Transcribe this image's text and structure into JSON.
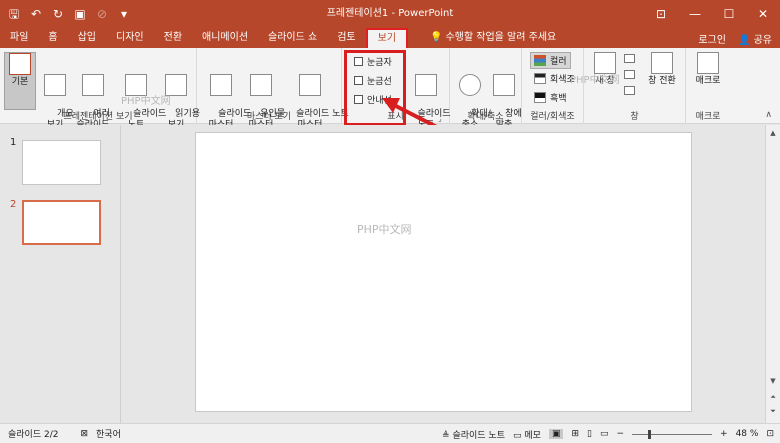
{
  "window": {
    "title": "프레젠테이션1 - PowerPoint"
  },
  "tabs": [
    {
      "label": "파일"
    },
    {
      "label": "홈"
    },
    {
      "label": "삽입"
    },
    {
      "label": "디자인"
    },
    {
      "label": "전환"
    },
    {
      "label": "애니메이션"
    },
    {
      "label": "슬라이드 쇼"
    },
    {
      "label": "검토"
    },
    {
      "label": "보기"
    }
  ],
  "tell_me": "수행할 작업을 알려 주세요",
  "account": {
    "login": "로그인",
    "share": "공유"
  },
  "ribbon": {
    "presentation_view": {
      "label": "프레젠테이션 보기",
      "buttons": [
        {
          "label": "기본"
        },
        {
          "label": "개요\n보기"
        },
        {
          "label": "여러\n슬라이드"
        },
        {
          "label": "슬라이드\n노트"
        },
        {
          "label": "읽기용\n보기"
        }
      ]
    },
    "master_view": {
      "label": "마스터 보기",
      "buttons": [
        {
          "label": "슬라이드\n마스터"
        },
        {
          "label": "유인물\n마스터"
        },
        {
          "label": "슬라이드 노트\n마스터"
        }
      ]
    },
    "show": {
      "label": "표시",
      "checkboxes": [
        {
          "label": "눈금자",
          "checked": false
        },
        {
          "label": "눈금선",
          "checked": false
        },
        {
          "label": "안내선",
          "checked": false
        }
      ],
      "notes_button": "슬라이드\n노트"
    },
    "zoom": {
      "label": "확대/축소",
      "buttons": [
        {
          "label": "확대/\n축소"
        },
        {
          "label": "창에\n맞춤"
        }
      ]
    },
    "color": {
      "label": "컬러/회색조",
      "options": [
        {
          "label": "컬러",
          "color": "#d0502a"
        },
        {
          "label": "회색조",
          "color": "#888888"
        },
        {
          "label": "흑백",
          "color": "#111111"
        }
      ]
    },
    "window": {
      "label": "창",
      "buttons": [
        {
          "label": "새 창"
        },
        {
          "label": "창 전환"
        }
      ]
    },
    "macro": {
      "label": "매크로",
      "buttons": [
        {
          "label": "매크로"
        }
      ]
    }
  },
  "slides": [
    {
      "number": "1"
    },
    {
      "number": "2"
    }
  ],
  "watermark": "PHP中文网",
  "status": {
    "slide_info": "슬라이드 2/2",
    "language": "한국어",
    "notes": "슬라이드 노트",
    "comments": "메모",
    "zoom": "48 %",
    "zoom_fraction": 0.48
  },
  "colors": {
    "brand": "#b7472a",
    "highlight": "#d81e1e"
  }
}
